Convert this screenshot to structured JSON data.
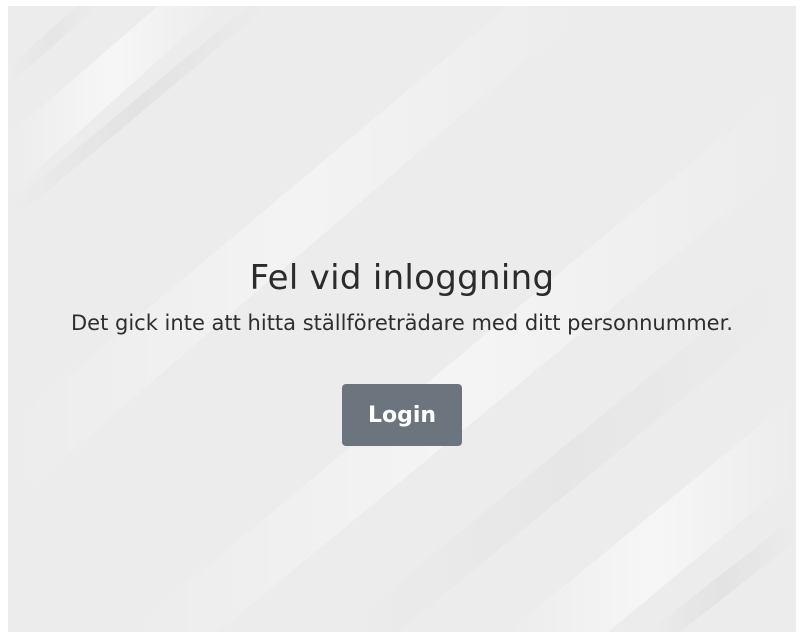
{
  "error": {
    "title": "Fel vid inloggning",
    "message": "Det gick inte att hitta ställföreträdare med ditt personnummer."
  },
  "actions": {
    "login_label": "Login"
  },
  "colors": {
    "background": "#ececec",
    "button": "#6c757d",
    "button_text": "#ffffff",
    "text": "#2b2b2b"
  }
}
